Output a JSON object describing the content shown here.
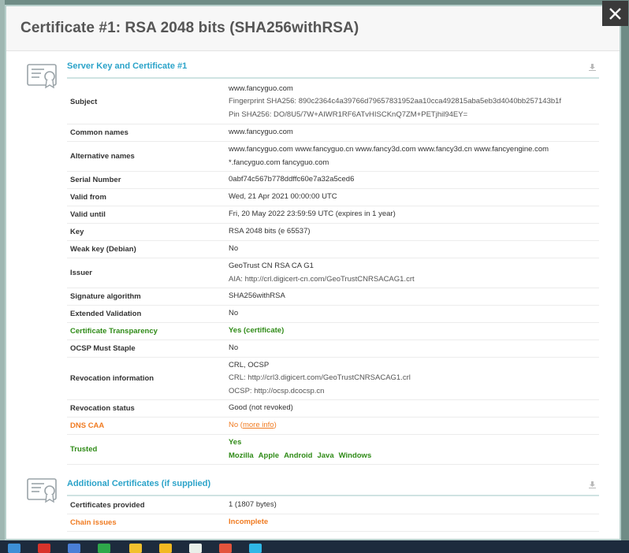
{
  "modal": {
    "title": "Certificate #1: RSA 2048 bits (SHA256withRSA)"
  },
  "section1": {
    "title": "Server Key and Certificate #1",
    "rows": {
      "subject": {
        "label": "Subject",
        "lines": [
          "www.fancyguo.com",
          "Fingerprint SHA256: 890c2364c4a39766d79657831952aa10cca492815aba5eb3d4040bb257143b1f",
          "Pin SHA256: DO/8U5/7W+AIWR1RF6ATvHISCKnQ7ZM+PETjhil94EY="
        ]
      },
      "common_names": {
        "label": "Common names",
        "value": "www.fancyguo.com"
      },
      "alt_names": {
        "label": "Alternative names",
        "lines": [
          "www.fancyguo.com www.fancyguo.cn www.fancy3d.com www.fancy3d.cn www.fancyengine.com",
          "*.fancyguo.com fancyguo.com"
        ]
      },
      "serial": {
        "label": "Serial Number",
        "value": "0abf74c567b778ddffc60e7a32a5ced6"
      },
      "valid_from": {
        "label": "Valid from",
        "value": "Wed, 21 Apr 2021 00:00:00 UTC"
      },
      "valid_until": {
        "label": "Valid until",
        "value": "Fri, 20 May 2022 23:59:59 UTC (expires in 1 year)"
      },
      "key": {
        "label": "Key",
        "value": "RSA 2048 bits (e 65537)"
      },
      "weak_key": {
        "label": "Weak key (Debian)",
        "value": "No"
      },
      "issuer": {
        "label": "Issuer",
        "lines": [
          "GeoTrust CN RSA CA G1",
          "AIA: http://crl.digicert-cn.com/GeoTrustCNRSACAG1.crt"
        ]
      },
      "sig_alg": {
        "label": "Signature algorithm",
        "value": "SHA256withRSA"
      },
      "ev": {
        "label": "Extended Validation",
        "value": "No"
      },
      "ct": {
        "label": "Certificate Transparency",
        "value": "Yes (certificate)"
      },
      "ocsp_staple": {
        "label": "OCSP Must Staple",
        "value": "No"
      },
      "revocation_info": {
        "label": "Revocation information",
        "lines": [
          "CRL, OCSP",
          "CRL: http://crl3.digicert.com/GeoTrustCNRSACAG1.crl",
          "OCSP: http://ocsp.dcocsp.cn"
        ]
      },
      "revocation_status": {
        "label": "Revocation status",
        "value": "Good (not revoked)"
      },
      "dns_caa": {
        "label": "DNS CAA",
        "value_prefix": "No (",
        "link": "more info",
        "value_suffix": ")"
      },
      "trusted": {
        "label": "Trusted",
        "value": "Yes",
        "stores": [
          "Mozilla",
          "Apple",
          "Android",
          "Java",
          "Windows"
        ]
      }
    }
  },
  "section2": {
    "title": "Additional Certificates (if supplied)",
    "rows": {
      "provided": {
        "label": "Certificates provided",
        "value": "1 (1807 bytes)"
      },
      "chain": {
        "label": "Chain issues",
        "value": "Incomplete"
      }
    }
  },
  "colors": {
    "accent": "#2ba3c9",
    "good": "#2f8b17",
    "warn": "#f07b21"
  },
  "icons": [
    "certificate-icon",
    "download-icon",
    "close-icon"
  ]
}
